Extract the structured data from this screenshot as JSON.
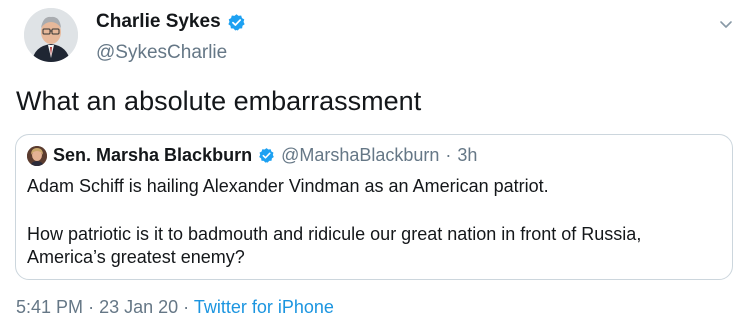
{
  "tweet": {
    "display_name": "Charlie Sykes",
    "handle": "@SykesCharlie",
    "text": "What an absolute embarrassment",
    "time": "5:41 PM",
    "date": "23 Jan 20",
    "source": "Twitter for iPhone",
    "separator": "·"
  },
  "quote": {
    "display_name": "Sen. Marsha Blackburn",
    "handle": "@MarshaBlackburn",
    "separator": "·",
    "time_ago": "3h",
    "lines": [
      "Adam Schiff is hailing Alexander Vindman as an American patriot.",
      "How patriotic is it to badmouth and ridicule our great nation in front of Russia,",
      "America’s greatest enemy?"
    ]
  },
  "icons": {
    "verified": "verified-badge-icon",
    "menu": "chevron-down-icon"
  },
  "colors": {
    "verified_blue": "#1da1f2",
    "link_blue": "#1b95e0",
    "secondary_text": "#657786",
    "border": "#ccd6dd"
  }
}
